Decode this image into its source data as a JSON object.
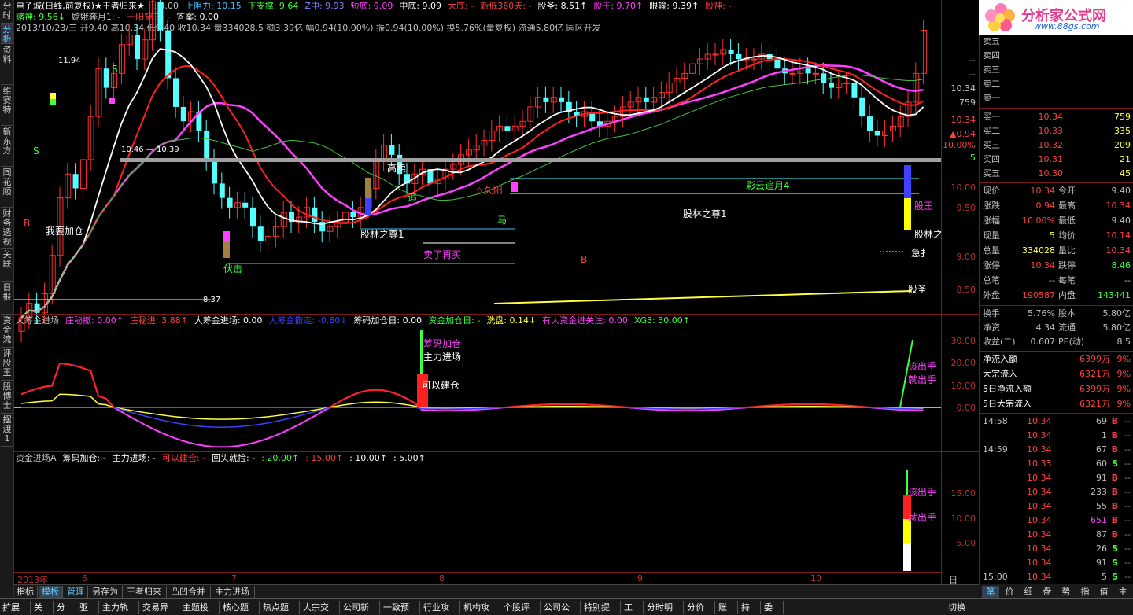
{
  "title": "电子城(日线,前复权)★王者归来★",
  "header": {
    "row1": [
      {
        "label": ": 0.00",
        "color": "#c0c0c0"
      },
      {
        "label": "上阻力: 10.15",
        "color": "#40c0ff"
      },
      {
        "label": "下支撑: 9.64",
        "color": "#40ff40"
      },
      {
        "label": "Z中: 9.93",
        "color": "#8080ff"
      },
      {
        "label": "短底: 9.09",
        "color": "#ff40ff"
      },
      {
        "label": "中底: 9.09",
        "color": "#ffffff"
      },
      {
        "label": "大底: -",
        "color": "#ff4040"
      },
      {
        "label": "新低360天: -",
        "color": "#ff4040"
      },
      {
        "label": "股圣: 8.51↑",
        "color": "#ffffff"
      },
      {
        "label": "股王: 9.70↑",
        "color": "#ff40ff"
      },
      {
        "label": "眼输: 9.39↑",
        "color": "#ffffff"
      },
      {
        "label": "股神: -",
        "color": "#ff4040"
      }
    ],
    "row2": [
      {
        "label": "赌神: 9.56↓",
        "color": "#40ff40"
      },
      {
        "label": "嫦娥奔月1: -",
        "color": "#c0c0c0"
      },
      {
        "label": "一阳穿三: -",
        "color": "#ff4040"
      },
      {
        "label": "答案: 0.00",
        "color": "#ffffff"
      }
    ],
    "row3": "2013/10/23/三 开9.40 高10.34 低9.40 收10.34 量334028.5 额3.39亿 幅0.94(10.00%) 振0.94(10.00%) 换5.76%(量复权) 流通5.80亿 园区开发"
  },
  "left_tabs": [
    "分时",
    "分析",
    "资料",
    "维赛特",
    "新东方",
    "同花顺",
    "财务透视",
    "关联",
    "日报",
    "资金流",
    "评股王",
    "股博士",
    "摆渡1"
  ],
  "price_axis": [
    "10.00",
    "9.50",
    "9.00",
    "8.50"
  ],
  "price_axis_top": [
    "--",
    "--",
    "10.34",
    "759",
    "10.34",
    "▲0.94",
    "10.00%",
    "5"
  ],
  "chart_labels": {
    "hi": "11.94",
    "lo": "8.37",
    "range": "10.46 — 10.39",
    "gaomai": "高卖",
    "zhui": "追",
    "jiuyang": "☆久阳",
    "caiyun": "彩云追月4",
    "guwang": "股王",
    "gulin": "股林之",
    "jizhang": "急扌",
    "gusheng": "股圣",
    "wojia": "我要加仓",
    "fuji": "伏击",
    "mai": "卖了再买",
    "gulin2": "股林之尊1",
    "gulin3": "股林之尊1",
    "ma": "马",
    "s1": "S",
    "b1": "B"
  },
  "ind1": {
    "header": [
      {
        "label": "大筹金进场",
        "color": "#c0c0c0"
      },
      {
        "label": "庄秘撤: 0.00↑",
        "color": "#ff40ff"
      },
      {
        "label": "庄秘进: 3.88↑",
        "color": "#ff4040"
      },
      {
        "label": "大筹金进场: 0.00",
        "color": "#ffffff"
      },
      {
        "label": "大筹金撤走: -0.80↓",
        "color": "#4040ff"
      },
      {
        "label": "筹码加仓日: 0.00",
        "color": "#ffffff"
      },
      {
        "label": "资金加仓日: -",
        "color": "#40ff40"
      },
      {
        "label": "洗盘: 0.14↓",
        "color": "#ffff40"
      },
      {
        "label": "有大资金进关注: 0.00",
        "color": "#ff40ff"
      },
      {
        "label": "XG3: 30.00↑",
        "color": "#40ff40"
      }
    ],
    "axis": [
      "30.00",
      "20.00",
      "10.00",
      "0.00"
    ],
    "labels": {
      "chouma": "筹码加仓",
      "zhuli": "主力进场",
      "keyi": "可以建仓",
      "gai": "该出手",
      "jiu": "就出手"
    }
  },
  "ind2": {
    "header": [
      {
        "label": "资金进场A",
        "color": "#c0c0c0"
      },
      {
        "label": "筹码加仓: -",
        "color": "#ffffff"
      },
      {
        "label": "主力进场: -",
        "color": "#ffffff"
      },
      {
        "label": "可以建仓: -",
        "color": "#ff4040"
      },
      {
        "label": "回头就捡: -",
        "color": "#ffffff"
      },
      {
        "label": ": 20.00↑",
        "color": "#40ff40"
      },
      {
        "label": ": 15.00↑",
        "color": "#ff4040"
      },
      {
        "label": ": 10.00↑",
        "color": "#ffffff"
      },
      {
        "label": ": 5.00↑",
        "color": "#ffffff"
      }
    ],
    "axis": [
      "15.00",
      "10.00",
      "5.00"
    ],
    "labels": {
      "gai": "该出手",
      "jiu": "就出手"
    }
  },
  "xaxis": [
    "2013年",
    "6",
    "7",
    "8",
    "9",
    "10"
  ],
  "xaxis_right": "日线",
  "quote": {
    "sell": [
      {
        "k": "卖五",
        "p": "",
        "v": ""
      },
      {
        "k": "卖四",
        "p": "",
        "v": ""
      },
      {
        "k": "卖三",
        "p": "",
        "v": ""
      },
      {
        "k": "卖二",
        "p": "",
        "v": ""
      },
      {
        "k": "卖一",
        "p": "",
        "v": ""
      }
    ],
    "buy": [
      {
        "k": "买一",
        "p": "10.34",
        "v": "759"
      },
      {
        "k": "买二",
        "p": "10.33",
        "v": "335"
      },
      {
        "k": "买三",
        "p": "10.32",
        "v": "209"
      },
      {
        "k": "买四",
        "p": "10.31",
        "v": "21"
      },
      {
        "k": "买五",
        "p": "10.30",
        "v": "45"
      }
    ],
    "stats": [
      {
        "k": "现价",
        "v1": "10.34",
        "c1": "#ff4040",
        "k2": "今开",
        "v2": "9.40",
        "c2": "#c0c0c0"
      },
      {
        "k": "涨跌",
        "v1": "0.94",
        "c1": "#ff4040",
        "k2": "最高",
        "v2": "10.34",
        "c2": "#ff4040"
      },
      {
        "k": "涨幅",
        "v1": "10.00%",
        "c1": "#ff4040",
        "k2": "最低",
        "v2": "9.40",
        "c2": "#c0c0c0"
      },
      {
        "k": "现量",
        "v1": "5",
        "c1": "#ffff40",
        "k2": "均价",
        "v2": "10.14",
        "c2": "#ff4040"
      },
      {
        "k": "总量",
        "v1": "334028",
        "c1": "#ffff40",
        "k2": "量比",
        "v2": "10.34",
        "c2": "#ff4040"
      },
      {
        "k": "涨停",
        "v1": "10.34",
        "c1": "#ff4040",
        "k2": "跌停",
        "v2": "8.46",
        "c2": "#40ff40"
      },
      {
        "k": "总笔",
        "v1": "--",
        "c1": "#c0c0c0",
        "k2": "每笔",
        "v2": "--",
        "c2": "#c0c0c0"
      },
      {
        "k": "外盘",
        "v1": "190587",
        "c1": "#ff4040",
        "k2": "内盘",
        "v2": "143441",
        "c2": "#40ff40"
      }
    ],
    "stats2": [
      {
        "k": "换手",
        "v1": "5.76%",
        "c1": "#c0c0c0",
        "k2": "股本",
        "v2": "5.80亿",
        "c2": "#c0c0c0"
      },
      {
        "k": "净资",
        "v1": "4.34",
        "c1": "#c0c0c0",
        "k2": "流通",
        "v2": "5.80亿",
        "c2": "#c0c0c0"
      },
      {
        "k": "收益(二)",
        "v1": "0.607",
        "c1": "#c0c0c0",
        "k2": "PE(动)",
        "v2": "8.5",
        "c2": "#c0c0c0"
      }
    ],
    "flows": [
      {
        "k": "净流入额",
        "v": "6399万",
        "p": "9%"
      },
      {
        "k": "大宗流入",
        "v": "6321万",
        "p": "9%"
      },
      {
        "k": "5日净流入额",
        "v": "6399万",
        "p": "9%"
      },
      {
        "k": "5日大宗流入",
        "v": "6321万",
        "p": "9%"
      }
    ],
    "ticks": [
      {
        "t": "14:58",
        "p": "10.34",
        "v": "69",
        "f": "B",
        "d": "--"
      },
      {
        "t": "",
        "p": "10.34",
        "v": "1",
        "f": "B",
        "d": "--"
      },
      {
        "t": "14:59",
        "p": "10.34",
        "v": "67",
        "f": "B",
        "d": "--"
      },
      {
        "t": "",
        "p": "10.33",
        "v": "60",
        "f": "S",
        "d": "--"
      },
      {
        "t": "",
        "p": "10.34",
        "v": "91",
        "f": "B",
        "d": "--"
      },
      {
        "t": "",
        "p": "10.34",
        "v": "233",
        "f": "B",
        "d": "--"
      },
      {
        "t": "",
        "p": "10.34",
        "v": "55",
        "f": "B",
        "d": "--"
      },
      {
        "t": "",
        "p": "10.34",
        "v": "651",
        "f": "B",
        "d": "--"
      },
      {
        "t": "",
        "p": "10.34",
        "v": "87",
        "f": "B",
        "d": "--"
      },
      {
        "t": "",
        "p": "10.34",
        "v": "26",
        "f": "S",
        "d": "--"
      },
      {
        "t": "",
        "p": "10.34",
        "v": "91",
        "f": "S",
        "d": "--"
      },
      {
        "t": "15:00",
        "p": "10.34",
        "v": "5",
        "f": "S",
        "d": "--"
      }
    ],
    "bottom_tabs": [
      "笔",
      "价",
      "细",
      "盘",
      "势",
      "指",
      "值",
      "主"
    ]
  },
  "logo": {
    "name": "分析家公式网",
    "url": "www.88gs.com"
  },
  "tabs1": [
    "指标",
    "模板",
    "管理",
    "另存为",
    "王者归来",
    "凸凹合并",
    "主力进场"
  ],
  "tabs2": [
    "扩展区",
    "关联",
    "分布",
    "驱动",
    "主力轨迹",
    "交易异动",
    "主题投资",
    "核心题材",
    "热点题材",
    "大宗交易",
    "公司新闻",
    "一致预期",
    "行业攻略",
    "机构攻略",
    "个股评级",
    "公司公告",
    "特别提示",
    "工具",
    "分时明细",
    "分价表",
    "账户",
    "持仓",
    "委托"
  ],
  "tabs2_right": "切换"
}
